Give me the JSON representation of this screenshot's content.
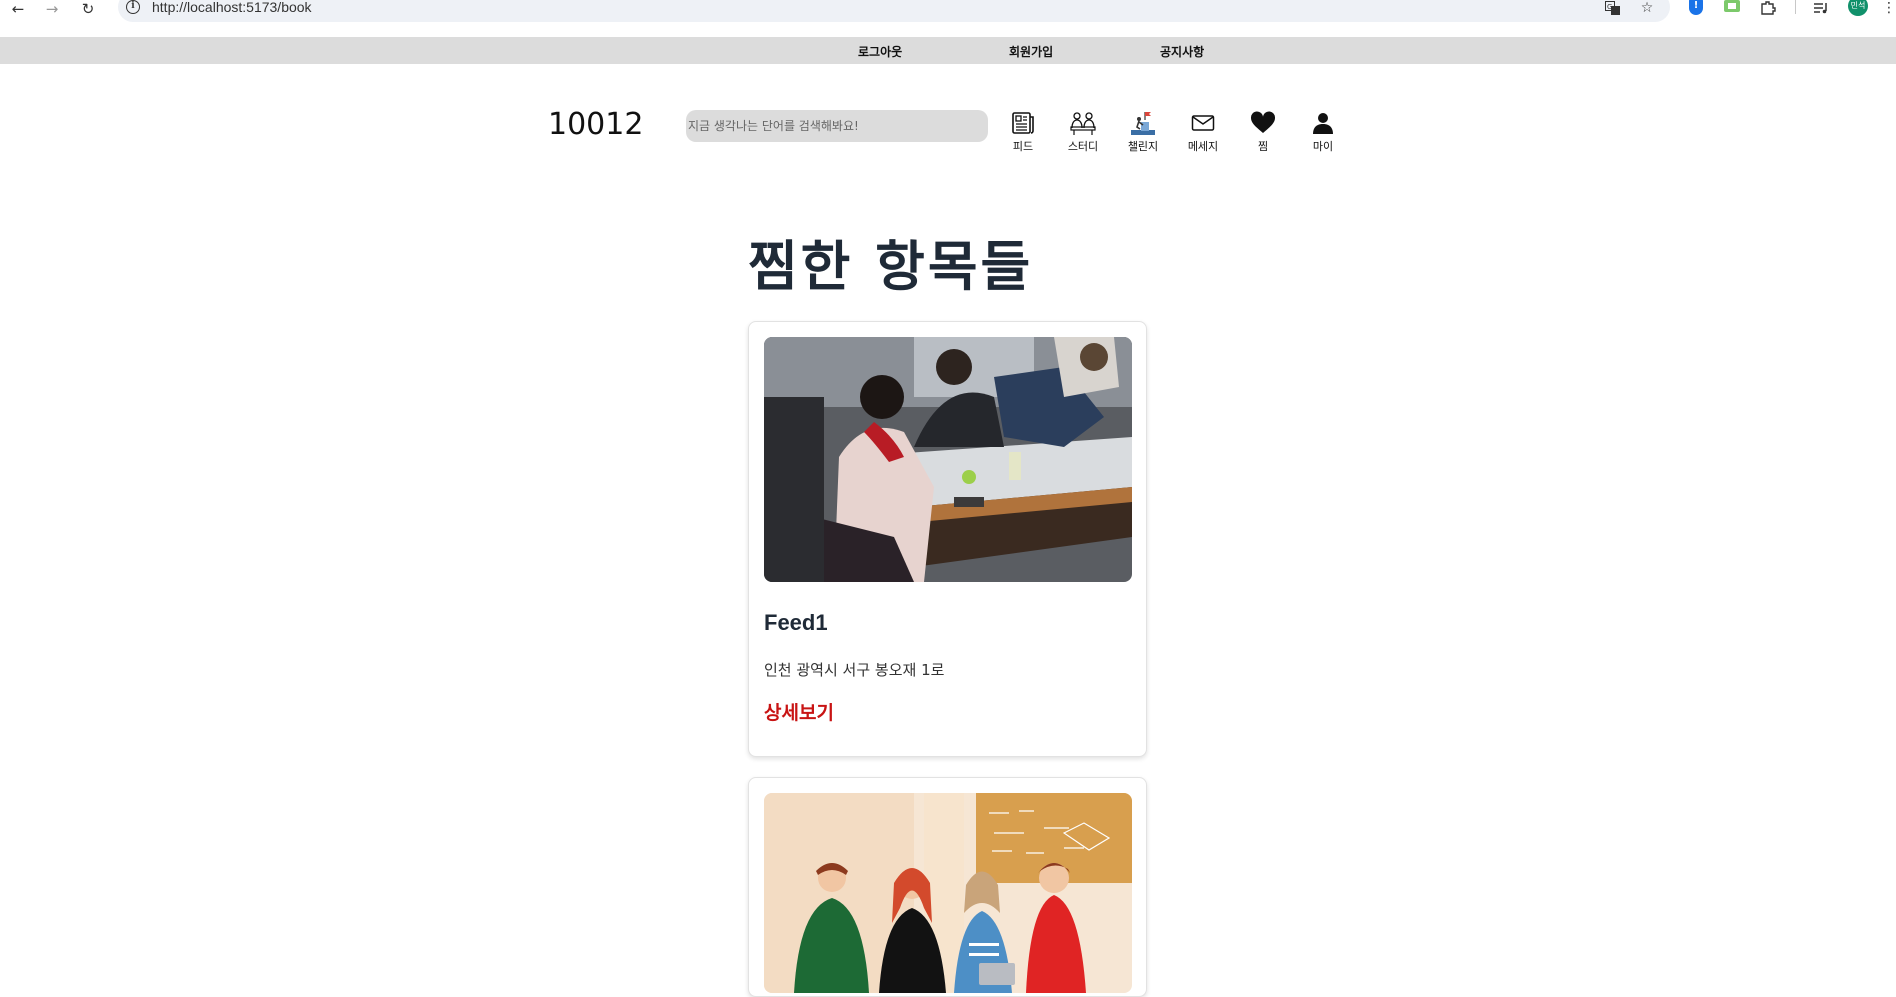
{
  "browser": {
    "url": "http://localhost:5173/book",
    "profile_initials": "민석"
  },
  "top_nav": {
    "items": [
      {
        "label": "로그아웃"
      },
      {
        "label": "회원가입"
      },
      {
        "label": "공지사항"
      }
    ]
  },
  "header": {
    "logo": "10012",
    "search_placeholder": "지금 생각나는 단어를 검색해봐요!",
    "nav": [
      {
        "label": "피드",
        "icon": "newspaper-icon"
      },
      {
        "label": "스터디",
        "icon": "study-group-icon"
      },
      {
        "label": "챌린지",
        "icon": "challenge-icon"
      },
      {
        "label": "메세지",
        "icon": "mail-icon"
      },
      {
        "label": "찜",
        "icon": "heart-icon"
      },
      {
        "label": "마이",
        "icon": "user-icon"
      }
    ]
  },
  "main": {
    "title": "찜한 항목들",
    "cards": [
      {
        "title": "Feed1",
        "address": "인천 광역시 서구 봉오재 1로",
        "link_label": "상세보기",
        "image": "students-studying-photo"
      },
      {
        "image": "team-illustration"
      }
    ]
  },
  "colors": {
    "link_red": "#c81414",
    "title_dark": "#1f2a37",
    "strip_gray": "#dcdcdc"
  }
}
